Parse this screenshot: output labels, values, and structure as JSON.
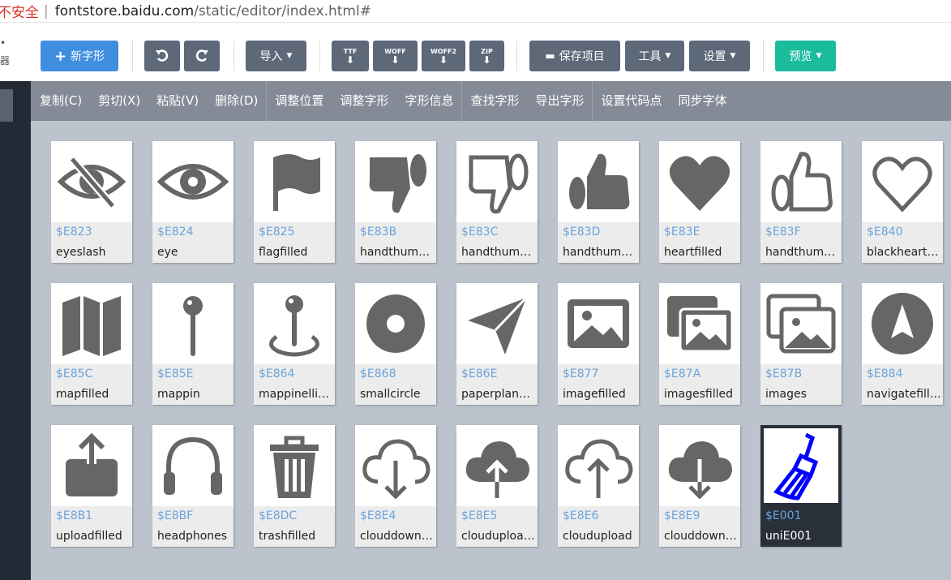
{
  "browser": {
    "security": "不安全",
    "host": "fontstore.baidu.com",
    "path": "/static/editor/index.html#"
  },
  "sidebar": {
    "clip1": "•",
    "clip2": "器"
  },
  "toolbar": {
    "new_glyph": "新字形",
    "import": "导入",
    "ttf": "TTF",
    "woff": "WOFF",
    "woff2": "WOFF2",
    "zip": "ZIP",
    "save_project": "保存项目",
    "tools": "工具",
    "settings": "设置",
    "preview": "预览"
  },
  "actions": [
    "复制(C)",
    "剪切(X)",
    "粘贴(V)",
    "删除(D)",
    "调整位置",
    "调整字形",
    "字形信息",
    "查找字形",
    "导出字形",
    "设置代码点",
    "同步字体"
  ],
  "glyphs": [
    {
      "code": "$E823",
      "name": "eyeslash",
      "icon": "eye-slash-icon"
    },
    {
      "code": "$E824",
      "name": "eye",
      "icon": "eye-icon"
    },
    {
      "code": "$E825",
      "name": "flagfilled",
      "icon": "flag-icon"
    },
    {
      "code": "$E83B",
      "name": "handthumbsdownfilled",
      "icon": "thumbs-down-filled-icon"
    },
    {
      "code": "$E83C",
      "name": "handthumbsdown",
      "icon": "thumbs-down-icon"
    },
    {
      "code": "$E83D",
      "name": "handthumbsupfilled",
      "icon": "thumbs-up-filled-icon"
    },
    {
      "code": "$E83E",
      "name": "heartfilled",
      "icon": "heart-filled-icon"
    },
    {
      "code": "$E83F",
      "name": "handthumbsup",
      "icon": "thumbs-up-icon"
    },
    {
      "code": "$E840",
      "name": "blackheartsuit",
      "icon": "heart-outline-icon"
    },
    {
      "code": "$E85C",
      "name": "mapfilled",
      "icon": "map-icon"
    },
    {
      "code": "$E85E",
      "name": "mappin",
      "icon": "map-pin-icon"
    },
    {
      "code": "$E864",
      "name": "mappinellipse",
      "icon": "map-pin-ellipse-icon"
    },
    {
      "code": "$E868",
      "name": "smallcircle",
      "icon": "small-circle-icon"
    },
    {
      "code": "$E86E",
      "name": "paperplanefilled",
      "icon": "paper-plane-icon"
    },
    {
      "code": "$E877",
      "name": "imagefilled",
      "icon": "image-filled-icon"
    },
    {
      "code": "$E87A",
      "name": "imagesfilled",
      "icon": "images-filled-icon"
    },
    {
      "code": "$E87B",
      "name": "images",
      "icon": "images-icon"
    },
    {
      "code": "$E884",
      "name": "navigatefilled",
      "icon": "navigate-icon"
    },
    {
      "code": "$E8B1",
      "name": "uploadfilled",
      "icon": "upload-icon"
    },
    {
      "code": "$E8BF",
      "name": "headphones",
      "icon": "headphones-icon"
    },
    {
      "code": "$E8DC",
      "name": "trashfilled",
      "icon": "trash-icon"
    },
    {
      "code": "$E8E4",
      "name": "clouddownload",
      "icon": "cloud-download-icon"
    },
    {
      "code": "$E8E5",
      "name": "clouduploadfilled",
      "icon": "cloud-upload-filled-icon"
    },
    {
      "code": "$E8E6",
      "name": "cloudupload",
      "icon": "cloud-upload-icon"
    },
    {
      "code": "$E8E9",
      "name": "clouddownloadfilled",
      "icon": "cloud-download-filled-icon"
    },
    {
      "code": "$E001",
      "name": "uniE001",
      "icon": "broom-icon",
      "selected": true
    }
  ],
  "colors": {
    "accent_blue": "#3f8ee0",
    "toolbar_gray": "#5d6878",
    "preview_green": "#1abc9c",
    "glyph_gray": "#666666",
    "code_blue": "#6aa4dc",
    "selected_glyph_blue": "#0000ff"
  }
}
